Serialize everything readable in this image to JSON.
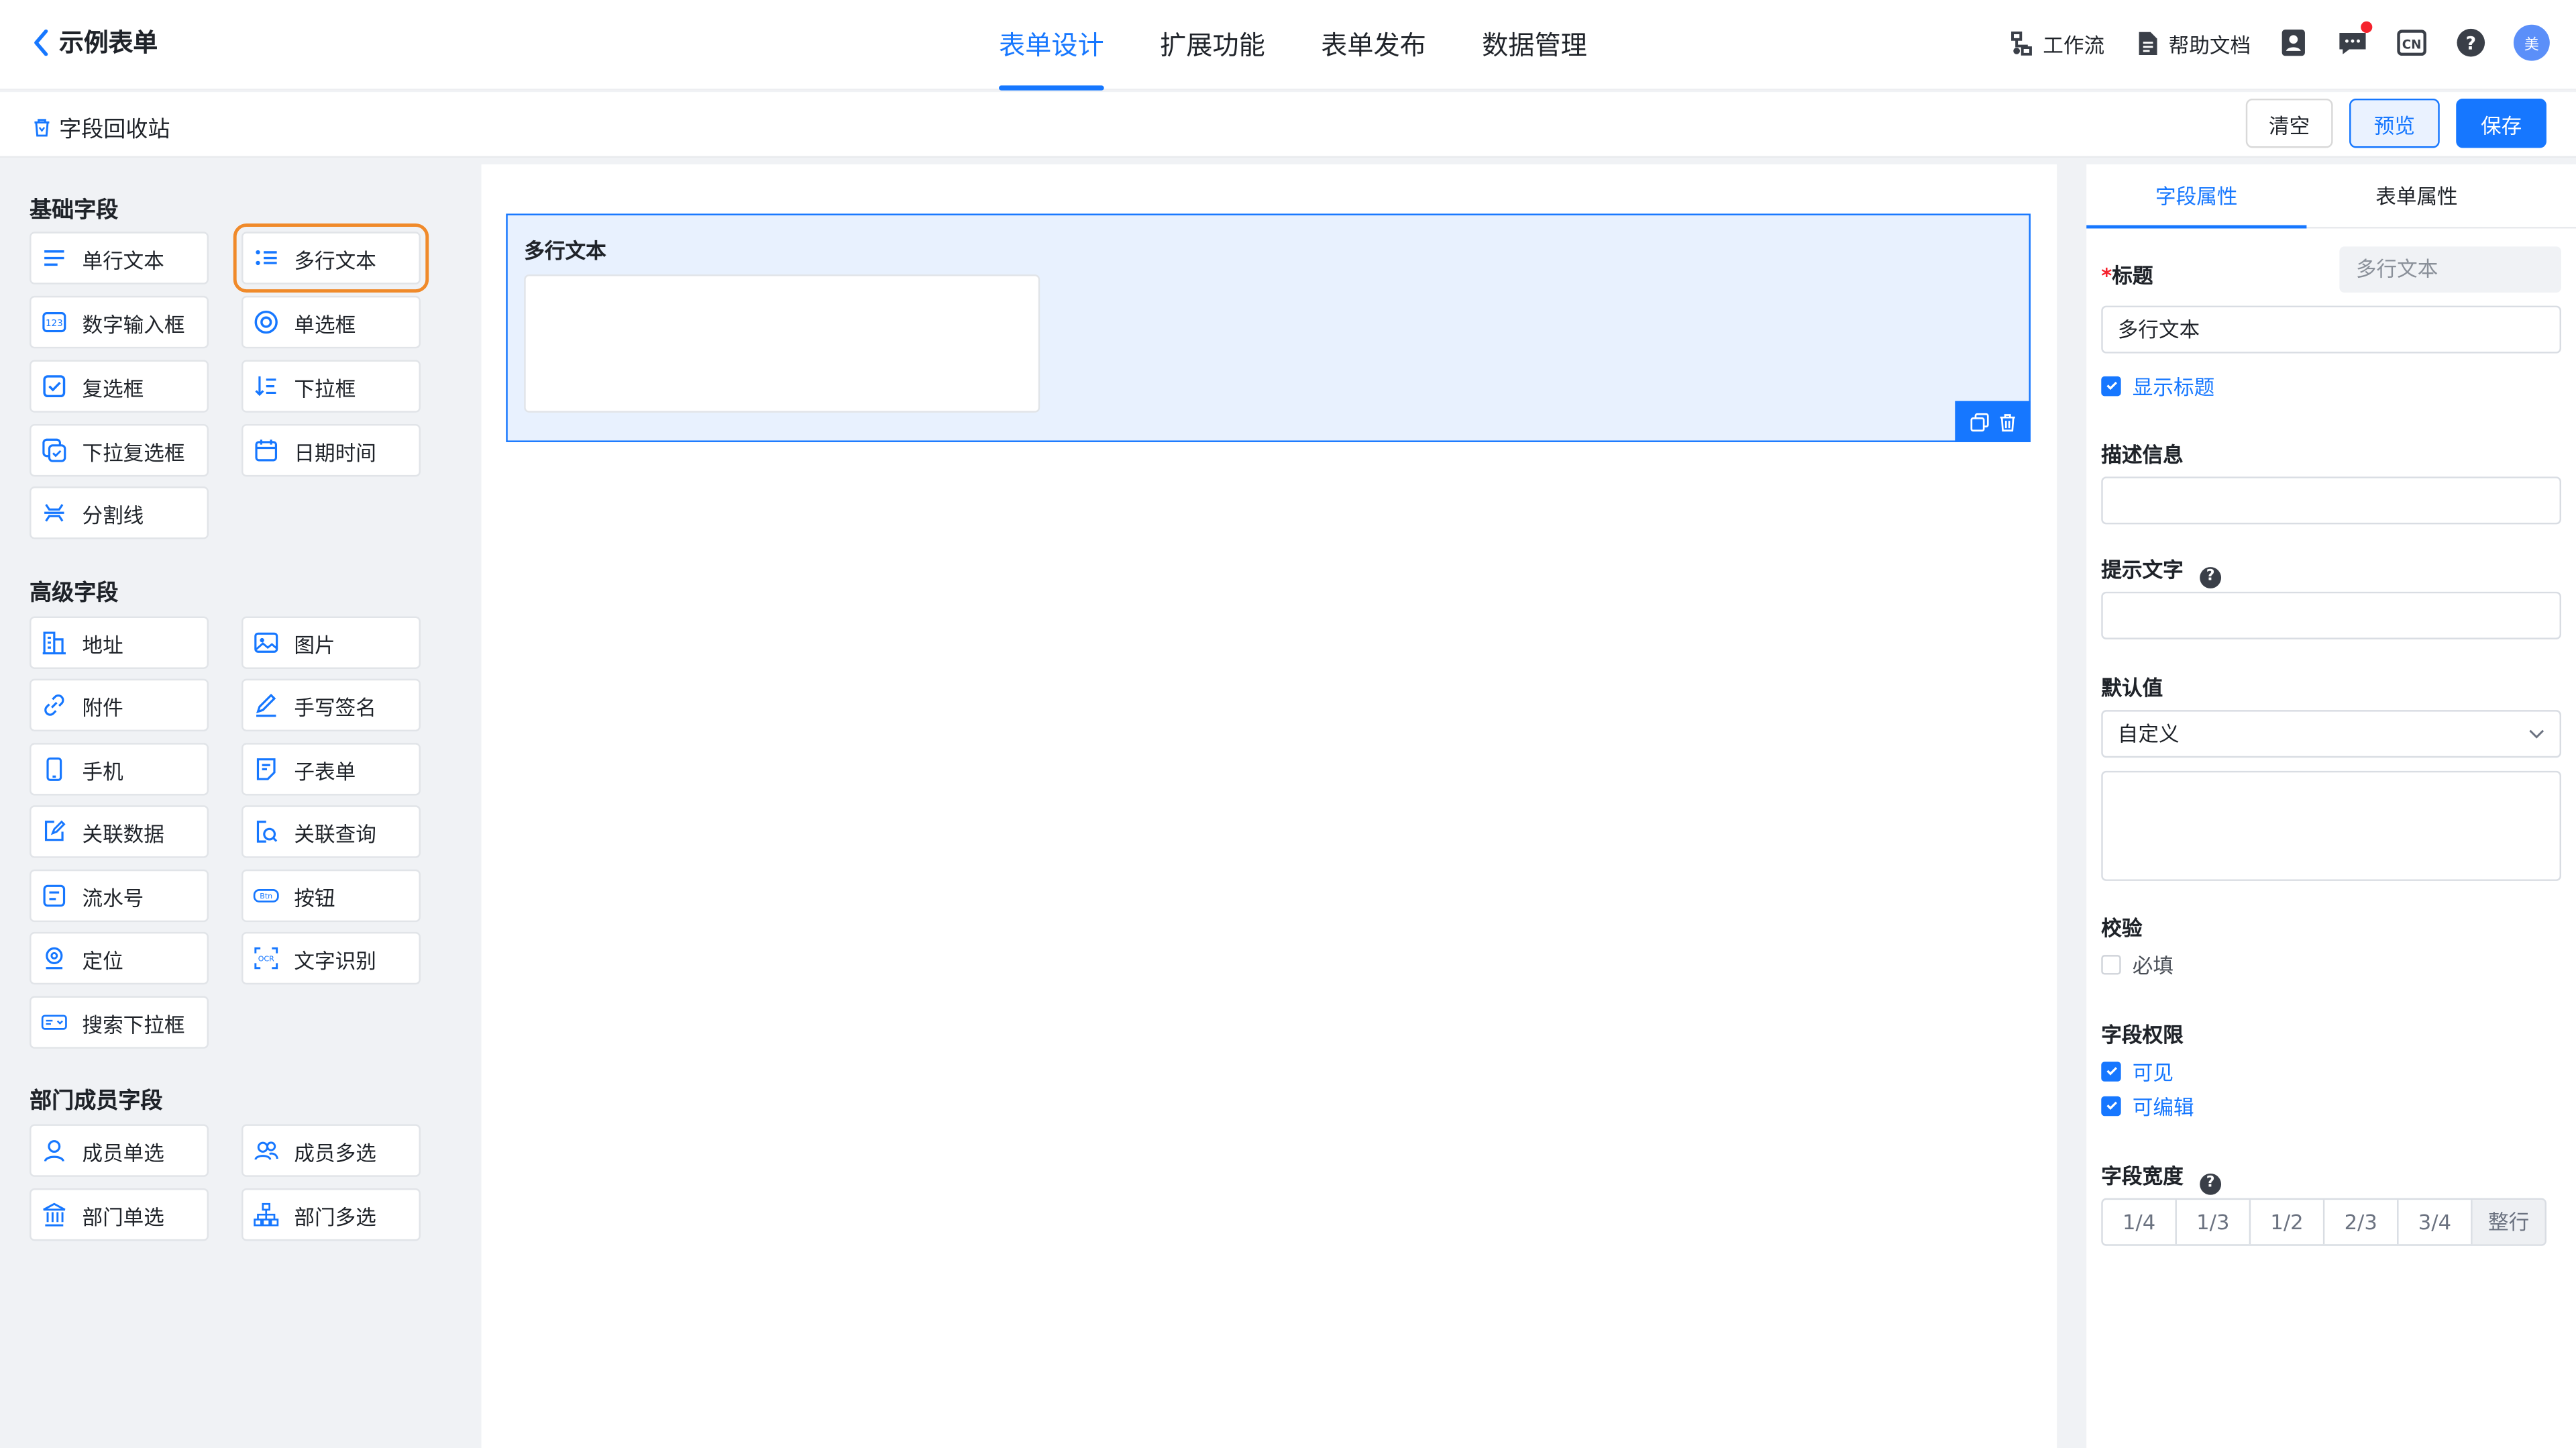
{
  "header": {
    "back_title": "示例表单",
    "tabs": [
      {
        "label": "表单设计",
        "active": true
      },
      {
        "label": "扩展功能",
        "active": false
      },
      {
        "label": "表单发布",
        "active": false
      },
      {
        "label": "数据管理",
        "active": false
      }
    ],
    "tools": {
      "workflow": "工作流",
      "help_docs": "帮助文档"
    },
    "avatar_text": "美",
    "accent_color": "#1677ff"
  },
  "subbar": {
    "recycle": "字段回收站",
    "clear": "清空",
    "preview": "预览",
    "save": "保存"
  },
  "palette": {
    "basic": {
      "title": "基础字段",
      "items": [
        "单行文本",
        "多行文本",
        "数字输入框",
        "单选框",
        "复选框",
        "下拉框",
        "下拉复选框",
        "日期时间",
        "分割线"
      ]
    },
    "advanced": {
      "title": "高级字段",
      "items": [
        "地址",
        "图片",
        "附件",
        "手写签名",
        "手机",
        "子表单",
        "关联数据",
        "关联查询",
        "流水号",
        "按钮",
        "定位",
        "文字识别",
        "搜索下拉框"
      ]
    },
    "member": {
      "title": "部门成员字段",
      "items": [
        "成员单选",
        "成员多选",
        "部门单选",
        "部门多选"
      ]
    },
    "selected": "多行文本"
  },
  "canvas": {
    "field_title": "多行文本"
  },
  "props": {
    "tabs": [
      {
        "label": "字段属性",
        "active": true
      },
      {
        "label": "表单属性",
        "active": false
      }
    ],
    "title_label": "标题",
    "title_type_badge": "多行文本",
    "title_value": "多行文本",
    "show_title": "显示标题",
    "desc_label": "描述信息",
    "placeholder_label": "提示文字",
    "default_label": "默认值",
    "default_select": "自定义",
    "validate_label": "校验",
    "required": "必填",
    "perm_label": "字段权限",
    "visible": "可见",
    "editable": "可编辑",
    "width_label": "字段宽度",
    "width_options": [
      "1/4",
      "1/3",
      "1/2",
      "2/3",
      "3/4",
      "整行"
    ],
    "width_selected": "整行"
  }
}
